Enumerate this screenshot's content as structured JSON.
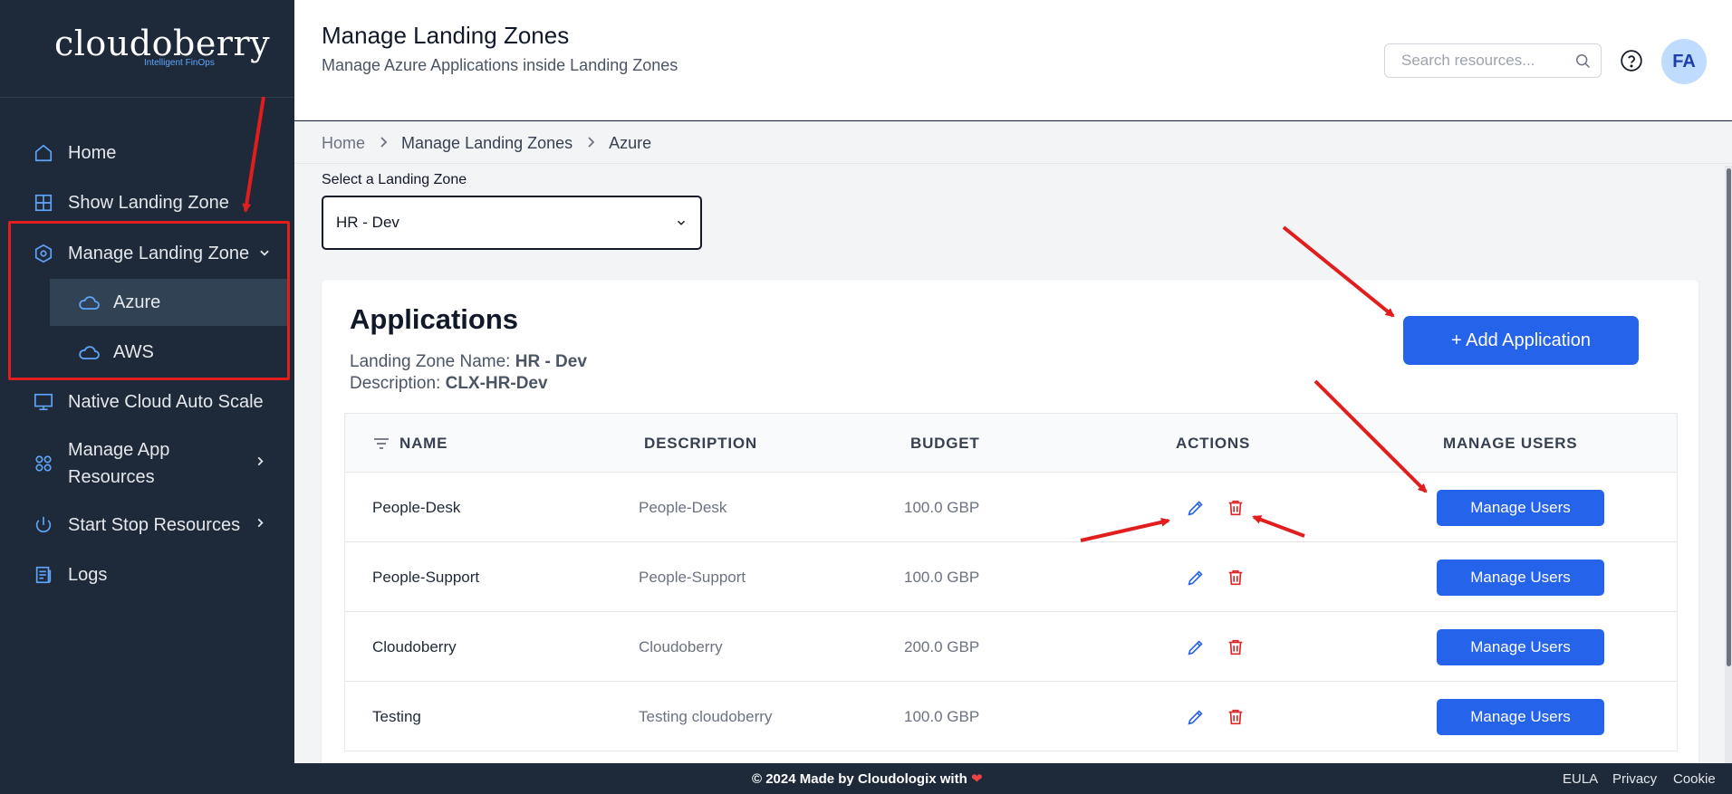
{
  "brand": {
    "name": "cloudoberry",
    "tagline": "Intelligent FinOps"
  },
  "sidebar": {
    "items": [
      {
        "label": "Home",
        "icon": "home-icon"
      },
      {
        "label": "Show Landing Zone",
        "icon": "grid-icon"
      },
      {
        "label": "Manage Landing Zone",
        "icon": "hexagon-settings-icon",
        "expanded": true
      },
      {
        "label": "Native Cloud Auto Scale",
        "icon": "monitor-icon"
      },
      {
        "label": "Manage App Resources",
        "icon": "apps-icon"
      },
      {
        "label": "Start Stop Resources",
        "icon": "power-icon"
      },
      {
        "label": "Logs",
        "icon": "logs-icon"
      }
    ],
    "subitems": [
      {
        "label": "Azure",
        "icon": "cloud-icon",
        "active": true
      },
      {
        "label": "AWS",
        "icon": "cloud-icon"
      }
    ]
  },
  "header": {
    "title": "Manage Landing Zones",
    "subtitle": "Manage Azure Applications inside Landing Zones",
    "search_placeholder": "Search resources...",
    "avatar": "FA"
  },
  "breadcrumb": [
    "Home",
    "Manage Landing Zones",
    "Azure"
  ],
  "landing_zone_select": {
    "label": "Select a Landing Zone",
    "value": "HR - Dev"
  },
  "applications": {
    "title": "Applications",
    "zone_name_label": "Landing Zone Name:",
    "zone_name": "HR - Dev",
    "description_label": "Description:",
    "description": "CLX-HR-Dev",
    "add_button": "+ Add Application",
    "columns": [
      "NAME",
      "DESCRIPTION",
      "BUDGET",
      "ACTIONS",
      "MANAGE USERS"
    ],
    "rows": [
      {
        "name": "People-Desk",
        "description": "People-Desk",
        "budget": "100.0 GBP",
        "manage": "Manage Users"
      },
      {
        "name": "People-Support",
        "description": "People-Support",
        "budget": "100.0 GBP",
        "manage": "Manage Users"
      },
      {
        "name": "Cloudoberry",
        "description": "Cloudoberry",
        "budget": "200.0 GBP",
        "manage": "Manage Users"
      },
      {
        "name": "Testing",
        "description": "Testing cloudoberry",
        "budget": "100.0 GBP",
        "manage": "Manage Users"
      }
    ]
  },
  "footer": {
    "copyright": "© 2024 Made by Cloudologix with",
    "links": [
      "EULA",
      "Privacy",
      "Cookie"
    ]
  },
  "colors": {
    "accent": "#2563eb",
    "sidebar": "#1e2a3a",
    "danger": "#dc2626",
    "annotation": "#e11d1d"
  }
}
